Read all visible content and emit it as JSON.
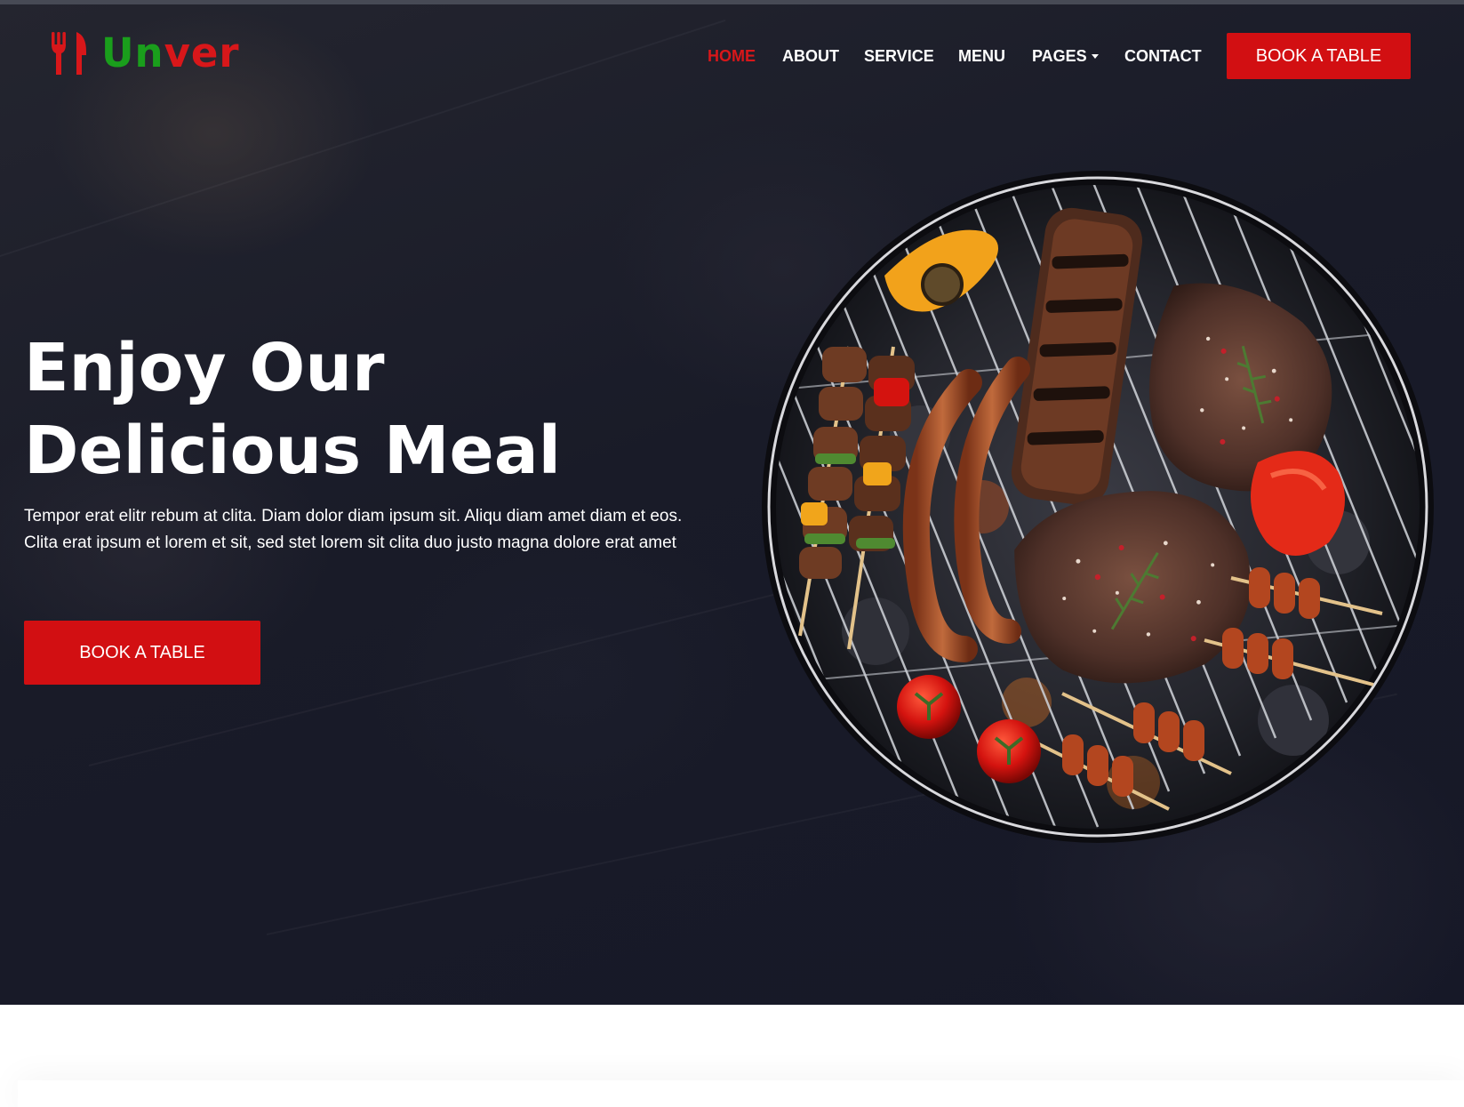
{
  "brand": {
    "name_part1": "Un",
    "name_part2": "ver",
    "logo_icon": "utensils-icon",
    "colors": {
      "green": "#1a9e1c",
      "red": "#d8171a"
    }
  },
  "nav": {
    "items": [
      {
        "label": "HOME",
        "active": true
      },
      {
        "label": "ABOUT",
        "active": false
      },
      {
        "label": "SERVICE",
        "active": false
      },
      {
        "label": "MENU",
        "active": false
      },
      {
        "label": "PAGES",
        "active": false,
        "dropdown": true
      },
      {
        "label": "CONTACT",
        "active": false
      }
    ],
    "cta_label": "BOOK A TABLE"
  },
  "hero": {
    "title_line1": "Enjoy Our",
    "title_line2": "Delicious Meal",
    "text": "Tempor erat elitr rebum at clita. Diam dolor diam ipsum sit. Aliqu diam amet diam et eos. Clita erat ipsum et lorem et sit, sed stet lorem sit clita duo justo magna dolore erat amet",
    "cta_label": "BOOK A TABLE",
    "image": "barbecue-grill-image"
  },
  "theme": {
    "primary": "#d20f12",
    "hero_bg": "#191b28",
    "text_light": "#ffffff"
  }
}
